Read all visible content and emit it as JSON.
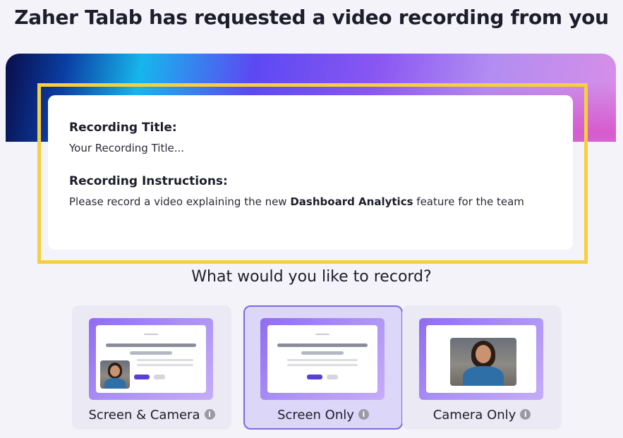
{
  "header": {
    "title": "Zaher Talab has requested a video recording from you"
  },
  "request": {
    "recording_title_heading": "Recording Title:",
    "recording_title_value": "Your Recording Title...",
    "instructions_heading": "Recording Instructions:",
    "instructions_before": "Please record a video explaining the new ",
    "instructions_highlight": "Dashboard Analytics",
    "instructions_after": " feature for the team"
  },
  "record_options": {
    "question": "What would you like to record?",
    "selected": "Screen Only",
    "options": [
      {
        "label": "Screen & Camera",
        "info_icon": "info-icon"
      },
      {
        "label": "Screen Only",
        "info_icon": "info-icon"
      },
      {
        "label": "Camera Only",
        "info_icon": "info-icon"
      }
    ]
  },
  "colors": {
    "highlight_frame": "#f6cf3d",
    "selected_border": "#7d69e3",
    "selected_background": "#dcd6f8",
    "option_background": "#ebe9f4",
    "accent_button": "#5a3fd6"
  }
}
